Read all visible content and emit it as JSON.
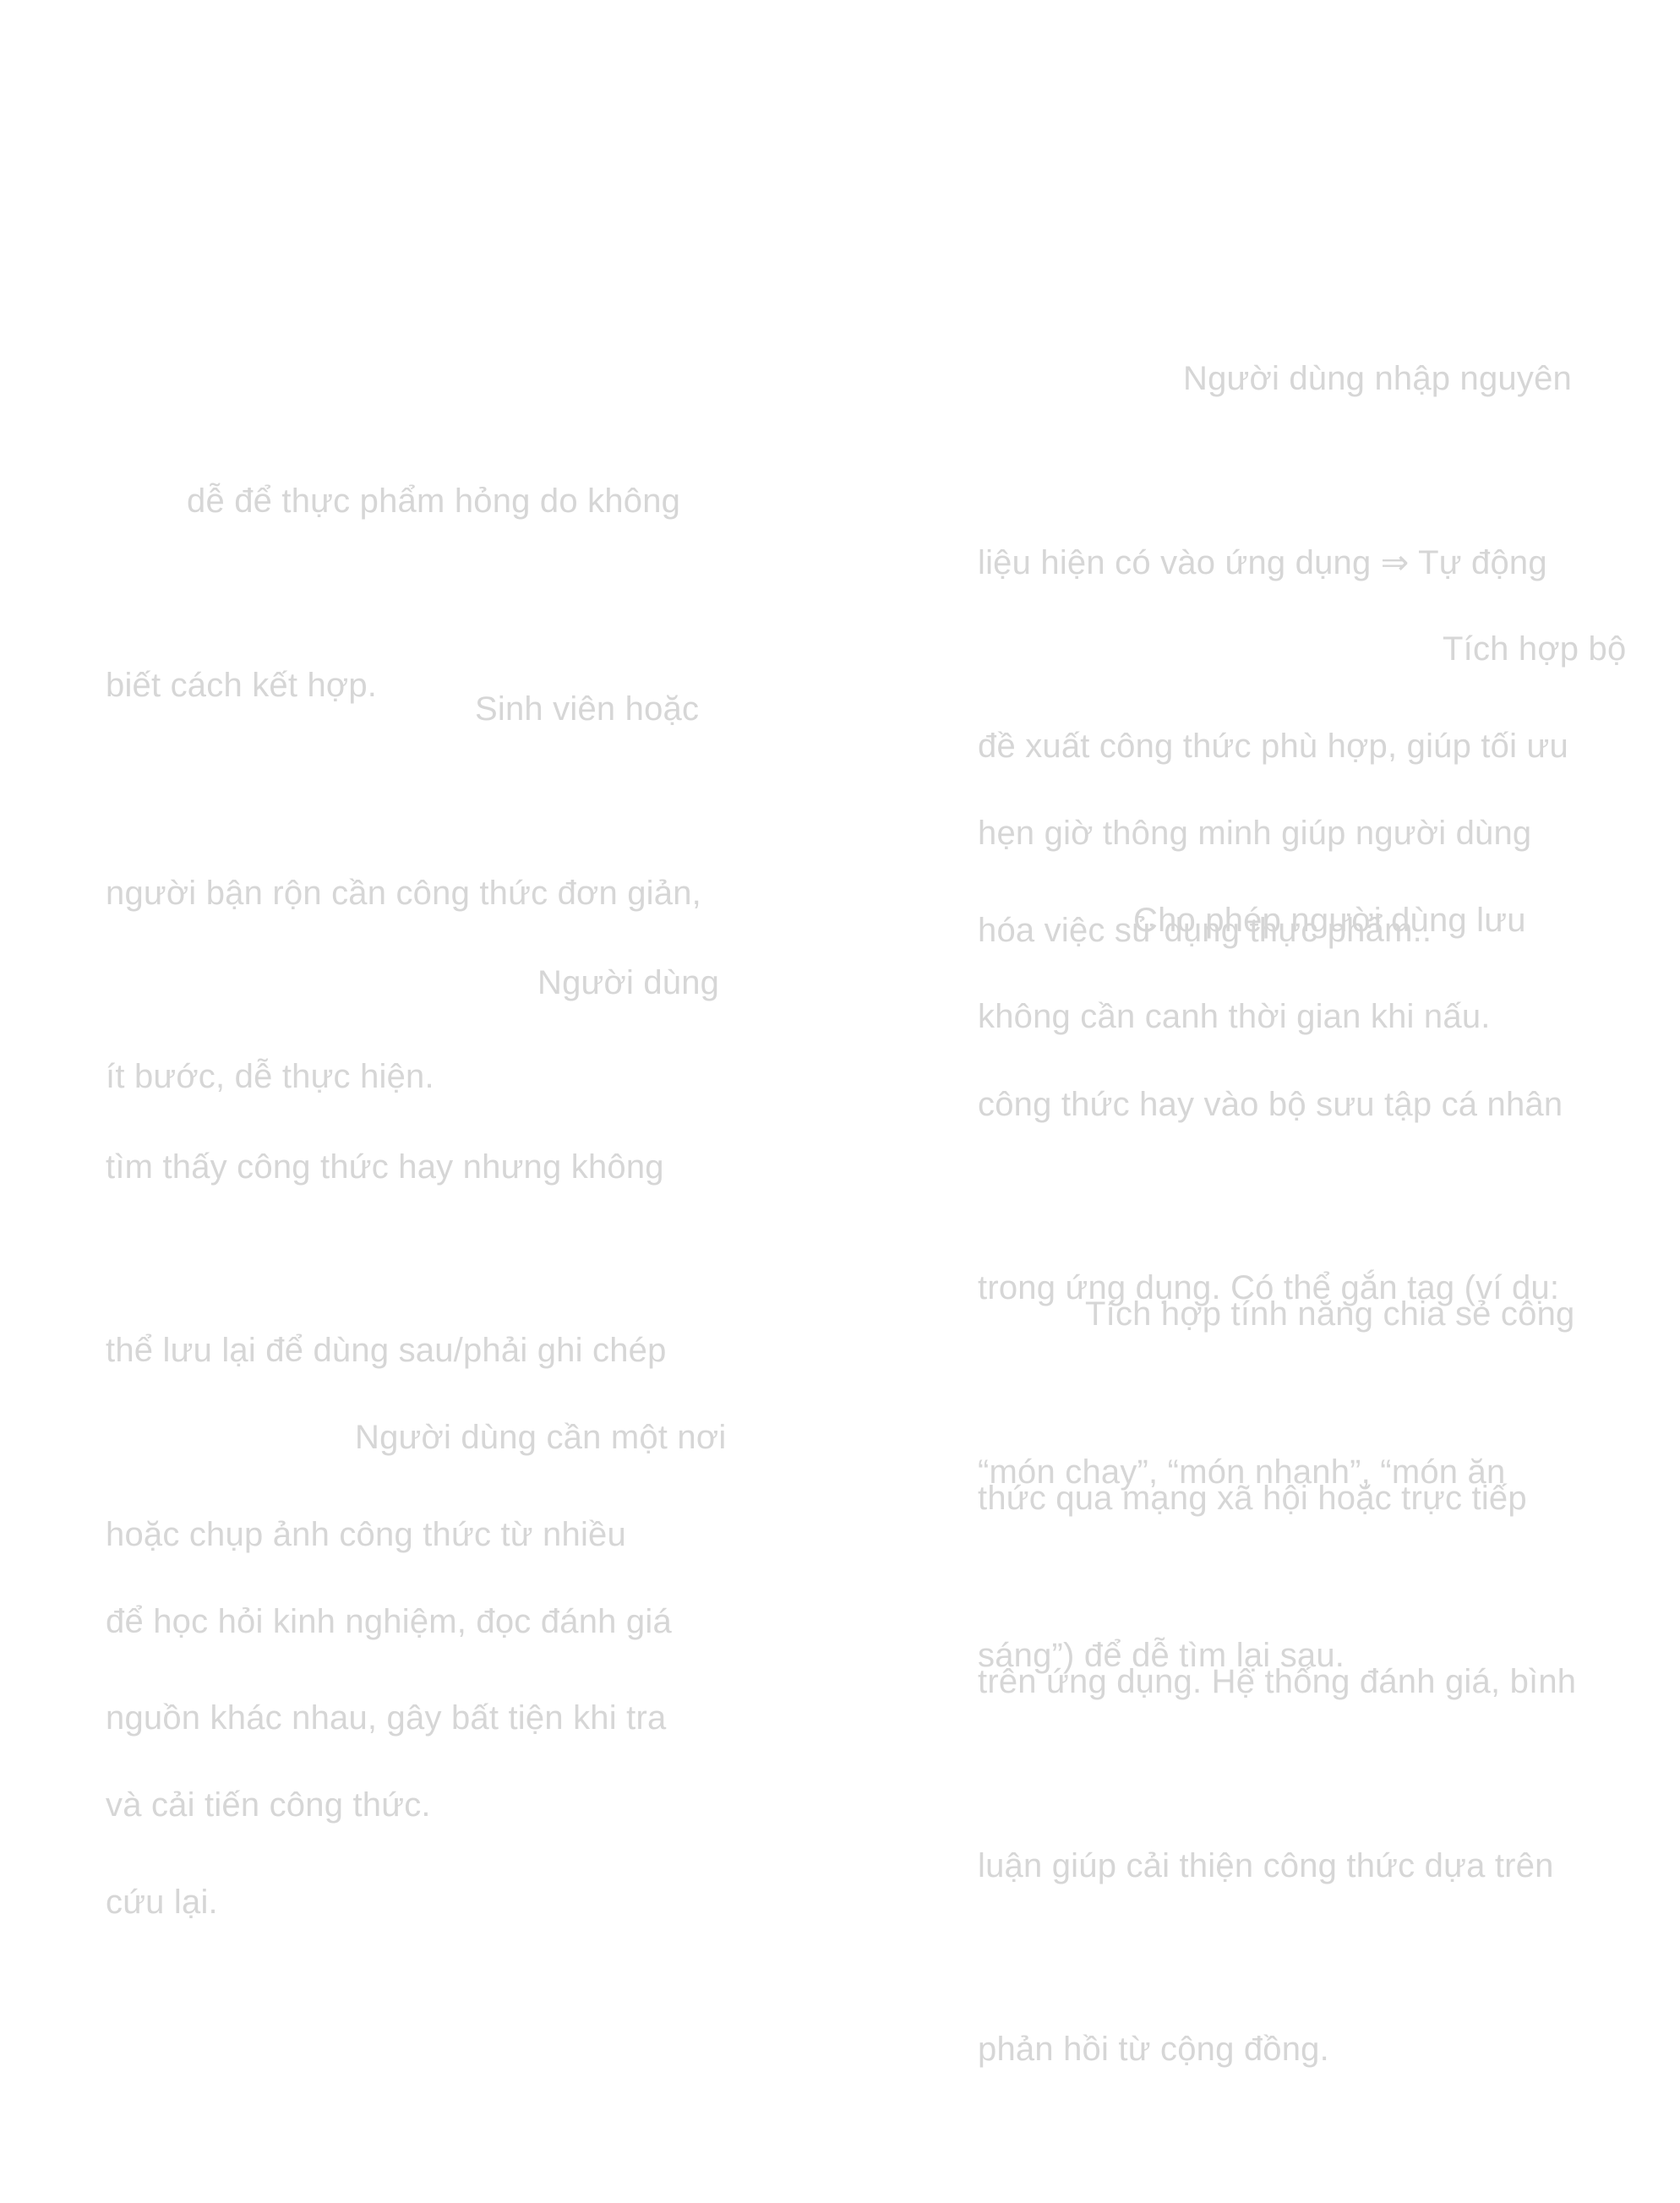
{
  "left_column": {
    "items": [
      {
        "lines": [
          "dễ để thực phẩm hỏng do không",
          "biết cách kết hợp."
        ]
      },
      {
        "lines": [
          "Sinh viên hoặc",
          "người bận rộn cần công thức đơn giản,",
          "ít bước, dễ thực hiện."
        ]
      },
      {
        "lines": [
          "Người dùng",
          "tìm thấy công thức hay nhưng không",
          "thể lưu lại để dùng sau/phải ghi chép",
          "hoặc chụp ảnh công thức từ nhiều",
          "nguồn khác nhau, gây bất tiện khi tra",
          "cứu lại."
        ]
      },
      {
        "lines": [
          "Người dùng cần một nơi",
          "để học hỏi kinh nghiệm, đọc đánh giá",
          "và cải tiến công thức."
        ]
      }
    ]
  },
  "right_column": {
    "items": [
      {
        "lines": [
          "Người dùng nhập nguyên",
          "liệu hiện có vào ứng dụng ⇒ Tự động",
          "đề xuất công thức phù hợp, giúp tối ưu",
          "hóa việc sử dụng thực phẩm.."
        ]
      },
      {
        "lines": [
          "Tích hợp bộ",
          "hẹn giờ thông minh giúp người dùng",
          "không cần canh thời gian khi nấu."
        ]
      },
      {
        "lines": [
          "Cho phép người dùng lưu",
          "công thức hay vào bộ sưu tập cá nhân",
          "trong ứng dụng. Có thể gắn tag (ví dụ:",
          "“món chay”, “món nhanh”, “món ăn",
          "sáng”) để dễ tìm lại sau."
        ]
      },
      {
        "lines": [
          "Tích hợp tính năng chia sẻ công",
          "thức qua mạng xã hội hoặc trực tiếp",
          "trên ứng dụng. Hệ thống đánh giá, bình",
          "luận giúp cải thiện công thức dựa trên",
          "phản hồi từ cộng đồng."
        ]
      }
    ]
  },
  "colors": {
    "background": "#ffffff",
    "text": "#d6d6d6"
  }
}
